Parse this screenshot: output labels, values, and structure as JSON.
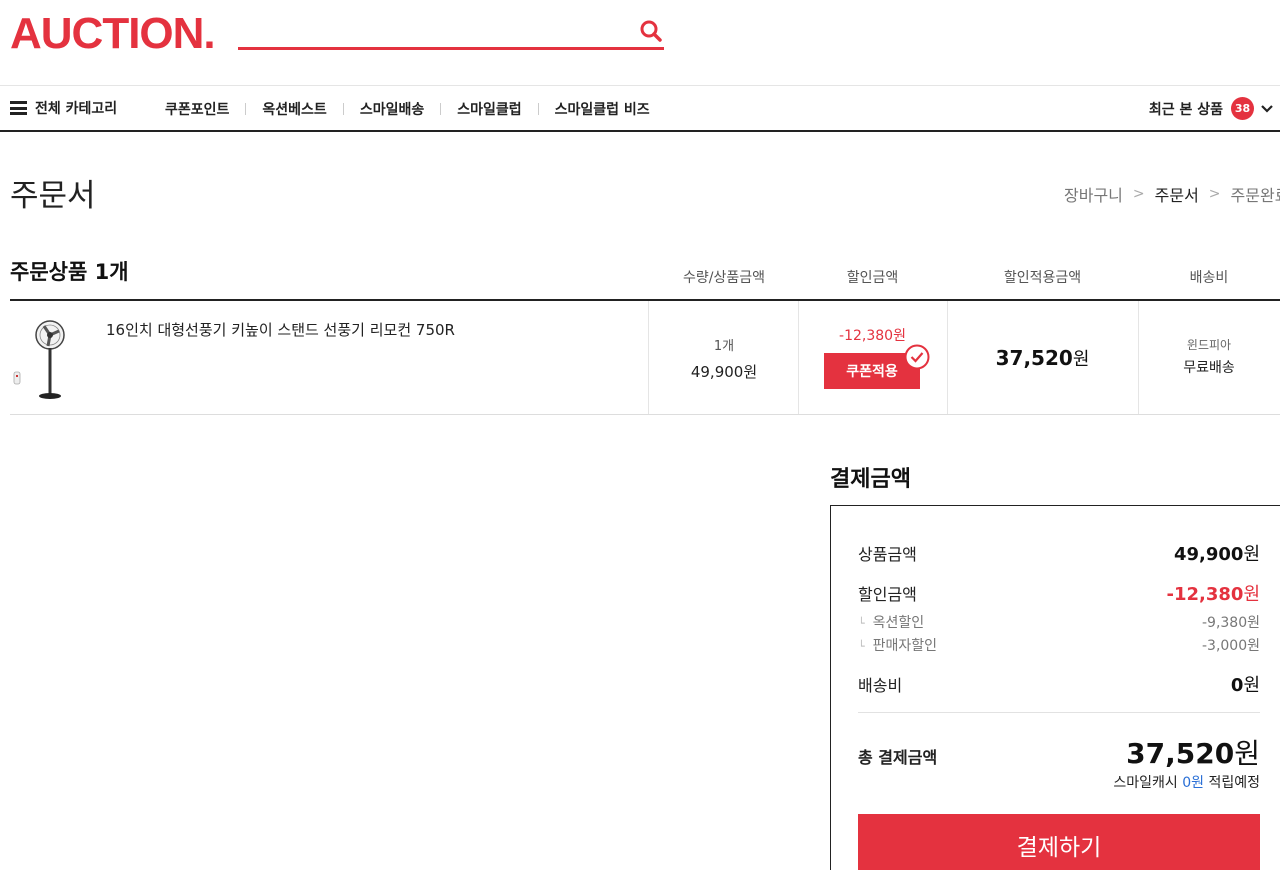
{
  "header": {
    "logo": "AUCTION.",
    "search": {
      "value": "",
      "placeholder": ""
    },
    "search_icon": "search-icon"
  },
  "nav": {
    "all_category": "전체 카테고리",
    "menu": [
      "쿠폰포인트",
      "옥션베스트",
      "스마일배송",
      "스마일클럽",
      "스마일클럽 비즈"
    ],
    "recent": {
      "label": "최근 본 상품",
      "count": "38"
    }
  },
  "page": {
    "title": "주문서",
    "steps": [
      "장바구니",
      "주문서",
      "주문완료"
    ]
  },
  "order": {
    "section_title": "주문상품 1개",
    "columns": [
      "수량/상품금액",
      "할인금액",
      "할인적용금액",
      "배송비"
    ],
    "items": [
      {
        "name": "16인치 대형선풍기 키높이 스탠드 선풍기 리모컨 750R",
        "qty": "1개",
        "price": "49,900원",
        "discount": "-12,380원",
        "coupon_label": "쿠폰적용",
        "final_amount": "37,520",
        "final_unit": "원",
        "seller": "윈드피아",
        "shipping": "무료배송"
      }
    ]
  },
  "payment": {
    "title": "결제금액",
    "product_amount": {
      "label": "상품금액",
      "value": "49,900",
      "unit": "원"
    },
    "discount_amount": {
      "label": "할인금액",
      "value": "-12,380",
      "unit": "원"
    },
    "sub_discounts": [
      {
        "label": "옥션할인",
        "value": "-9,380원"
      },
      {
        "label": "판매자할인",
        "value": "-3,000원"
      }
    ],
    "shipping": {
      "label": "배송비",
      "value": "0",
      "unit": "원"
    },
    "total": {
      "label": "총 결제금액",
      "value": "37,520",
      "unit": "원"
    },
    "cash_note": {
      "prefix": "스마일캐시",
      "amount": "0원",
      "suffix": "적립예정"
    },
    "pay_button": "결제하기"
  },
  "colors": {
    "brand": "#e4323f",
    "link": "#2a6fd6"
  }
}
